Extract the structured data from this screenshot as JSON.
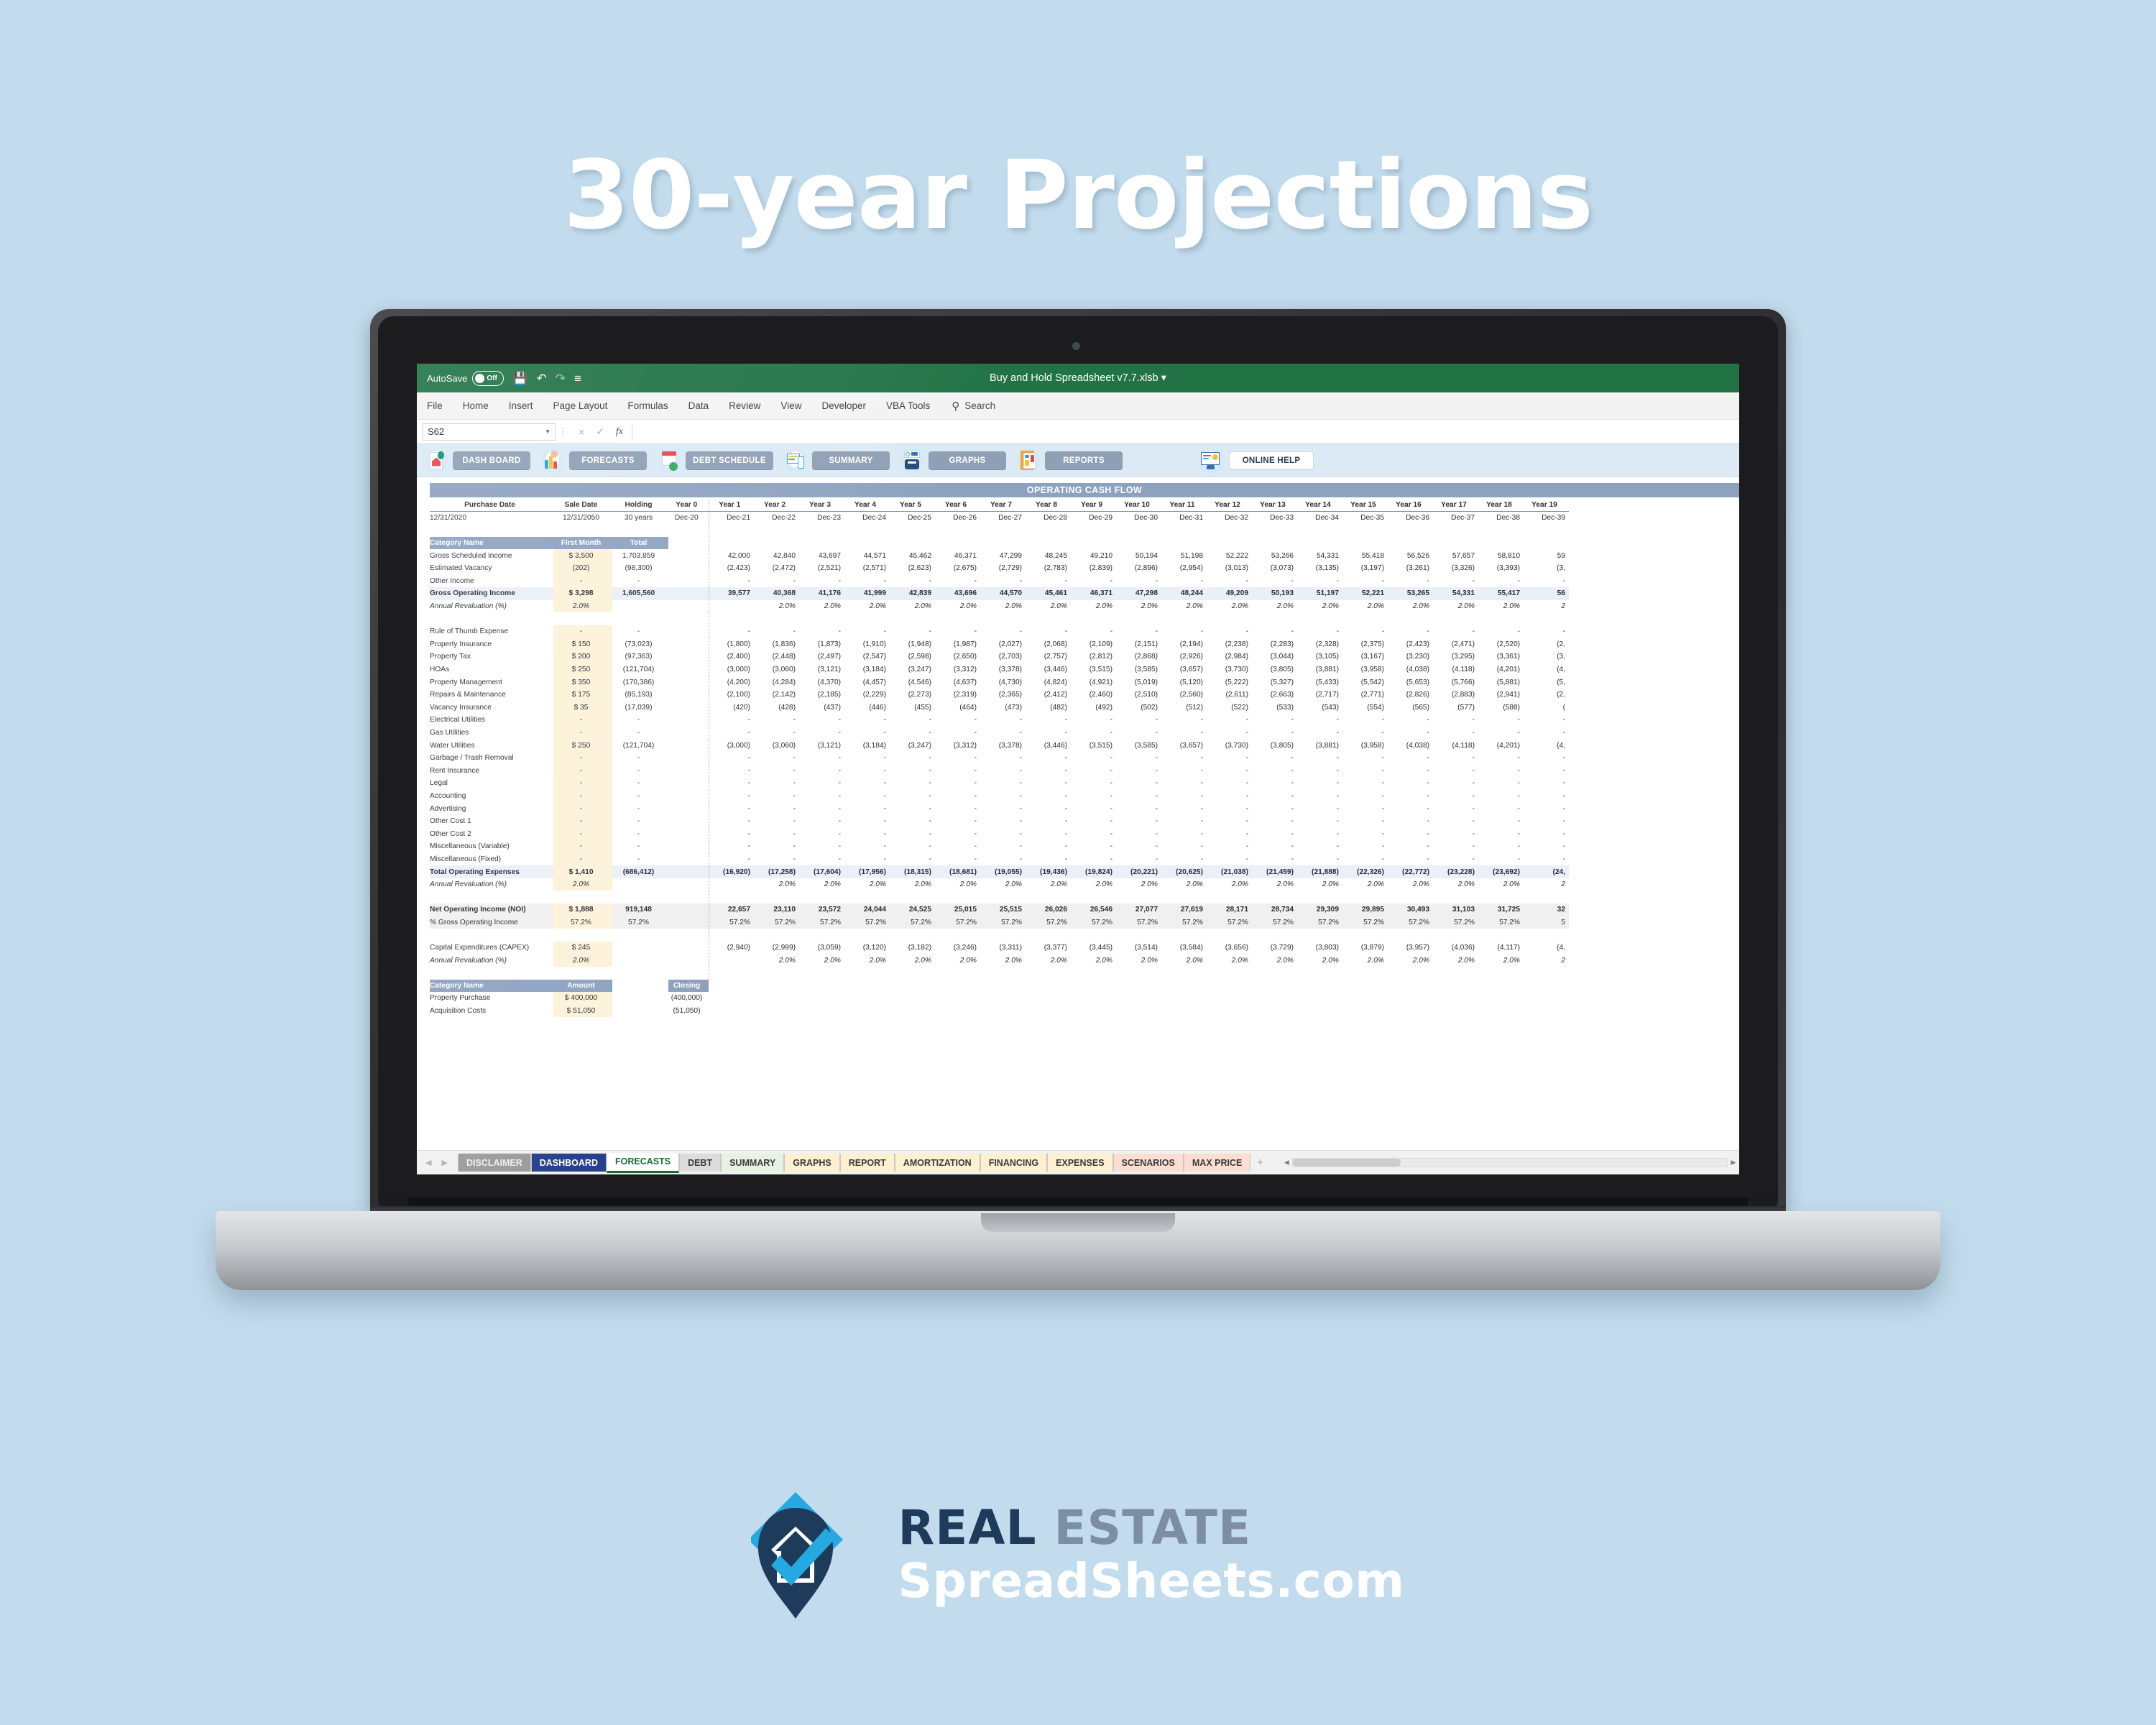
{
  "hero": {
    "title": "30-year Projections"
  },
  "excel": {
    "titlebar": {
      "autosave_label": "AutoSave",
      "autosave_state": "Off",
      "doc_title": "Buy and Hold Spreadsheet v7.7.xlsb",
      "qat_icons": [
        "save-icon",
        "undo-icon",
        "redo-icon",
        "customize-qat-icon"
      ]
    },
    "ribbon_tabs": [
      "File",
      "Home",
      "Insert",
      "Page Layout",
      "Formulas",
      "Data",
      "Review",
      "View",
      "Developer",
      "VBA Tools"
    ],
    "search_label": "Search",
    "formula_bar": {
      "name_box": "S62",
      "cancel": "×",
      "enter": "✓",
      "fx": "fx",
      "value": ""
    },
    "macro_buttons": [
      {
        "label": "DASH BOARD",
        "icon": "house-report-icon"
      },
      {
        "label": "FORECASTS",
        "icon": "chart-person-icon"
      },
      {
        "label": "DEBT SCHEDULE",
        "icon": "calendar-check-icon"
      },
      {
        "label": "SUMMARY",
        "icon": "monitor-mobile-icon"
      },
      {
        "label": "GRAPHS",
        "icon": "analytics-search-icon"
      },
      {
        "label": "REPORTS",
        "icon": "clipboard-report-icon"
      },
      {
        "label": "ONLINE HELP",
        "icon": "settings-monitor-icon"
      }
    ],
    "sheet_tabs": [
      {
        "label": "DISCLAIMER",
        "style": "t-disclaimer",
        "active": false
      },
      {
        "label": "DASHBOARD",
        "style": "t-dashboard",
        "active": false
      },
      {
        "label": "FORECASTS",
        "style": "t-active",
        "active": true
      },
      {
        "label": "DEBT",
        "style": "t-debt",
        "active": false
      },
      {
        "label": "SUMMARY",
        "style": "t-green",
        "active": false
      },
      {
        "label": "GRAPHS",
        "style": "t-yellow",
        "active": false
      },
      {
        "label": "REPORT",
        "style": "t-yellow",
        "active": false
      },
      {
        "label": "AMORTIZATION",
        "style": "t-yellow",
        "active": false
      },
      {
        "label": "FINANCING",
        "style": "t-yellow",
        "active": false
      },
      {
        "label": "EXPENSES",
        "style": "t-yellow",
        "active": false
      },
      {
        "label": "SCENARIOS",
        "style": "t-pink",
        "active": false
      },
      {
        "label": "MAX PRICE",
        "style": "t-pink",
        "active": false
      }
    ],
    "add_sheet_label": "+"
  },
  "chart_data": {
    "type": "table",
    "title": "OPERATING CASH FLOW",
    "meta_headers": [
      "Purchase Date",
      "Sale Date",
      "Holding",
      "Year 0"
    ],
    "meta_values": [
      "12/31/2020",
      "12/31/2050",
      "30 years",
      "Dec-20"
    ],
    "year_headers": [
      "Year 1",
      "Year 2",
      "Year 3",
      "Year 4",
      "Year 5",
      "Year 6",
      "Year 7",
      "Year 8",
      "Year 9",
      "Year 10",
      "Year 11",
      "Year 12",
      "Year 13",
      "Year 14",
      "Year 15",
      "Year 16",
      "Year 17",
      "Year 18",
      "Year 19"
    ],
    "year_dates": [
      "Dec-21",
      "Dec-22",
      "Dec-23",
      "Dec-24",
      "Dec-25",
      "Dec-26",
      "Dec-27",
      "Dec-28",
      "Dec-29",
      "Dec-30",
      "Dec-31",
      "Dec-32",
      "Dec-33",
      "Dec-34",
      "Dec-35",
      "Dec-36",
      "Dec-37",
      "Dec-38",
      "Dec-39"
    ],
    "section_headers": [
      "Category Name",
      "First Month",
      "Total"
    ],
    "rows": [
      {
        "label": "Gross Scheduled Income",
        "first_month": "$ 3,500",
        "total": "1,703,859",
        "values": [
          "42,000",
          "42,840",
          "43,697",
          "44,571",
          "45,462",
          "46,371",
          "47,299",
          "48,245",
          "49,210",
          "50,194",
          "51,198",
          "52,222",
          "53,266",
          "54,331",
          "55,418",
          "56,526",
          "57,657",
          "58,810",
          "59"
        ]
      },
      {
        "label": "Estimated Vacancy",
        "first_month": "(202)",
        "total": "(98,300)",
        "values": [
          "(2,423)",
          "(2,472)",
          "(2,521)",
          "(2,571)",
          "(2,623)",
          "(2,675)",
          "(2,729)",
          "(2,783)",
          "(2,839)",
          "(2,896)",
          "(2,954)",
          "(3,013)",
          "(3,073)",
          "(3,135)",
          "(3,197)",
          "(3,261)",
          "(3,326)",
          "(3,393)",
          "(3,"
        ]
      },
      {
        "label": "Other Income",
        "first_month": "-",
        "total": "-",
        "values": [
          "-",
          "-",
          "-",
          "-",
          "-",
          "-",
          "-",
          "-",
          "-",
          "-",
          "-",
          "-",
          "-",
          "-",
          "-",
          "-",
          "-",
          "-",
          "-"
        ]
      },
      {
        "label": "Gross Operating Income",
        "first_month": "$ 3,298",
        "total": "1,605,560",
        "style": "total-blue",
        "values": [
          "39,577",
          "40,368",
          "41,176",
          "41,999",
          "42,839",
          "43,696",
          "44,570",
          "45,461",
          "46,371",
          "47,298",
          "48,244",
          "49,209",
          "50,193",
          "51,197",
          "52,221",
          "53,265",
          "54,331",
          "55,417",
          "56"
        ]
      },
      {
        "label": "Annual Revaluation (%)",
        "first_month": "2.0%",
        "total": "",
        "style": "italic-cream",
        "values": [
          "",
          "2.0%",
          "2.0%",
          "2.0%",
          "2.0%",
          "2.0%",
          "2.0%",
          "2.0%",
          "2.0%",
          "2.0%",
          "2.0%",
          "2.0%",
          "2.0%",
          "2.0%",
          "2.0%",
          "2.0%",
          "2.0%",
          "2.0%",
          "2"
        ]
      },
      {
        "label": "",
        "first_month": "",
        "total": "",
        "style": "gap",
        "values": []
      },
      {
        "label": "Rule of Thumb Expense",
        "first_month": "-",
        "total": "-",
        "values": [
          "-",
          "-",
          "-",
          "-",
          "-",
          "-",
          "-",
          "-",
          "-",
          "-",
          "-",
          "-",
          "-",
          "-",
          "-",
          "-",
          "-",
          "-",
          "-"
        ]
      },
      {
        "label": "Property Insurance",
        "first_month": "$ 150",
        "total": "(73,023)",
        "values": [
          "(1,800)",
          "(1,836)",
          "(1,873)",
          "(1,910)",
          "(1,948)",
          "(1,987)",
          "(2,027)",
          "(2,068)",
          "(2,109)",
          "(2,151)",
          "(2,194)",
          "(2,238)",
          "(2,283)",
          "(2,328)",
          "(2,375)",
          "(2,423)",
          "(2,471)",
          "(2,520)",
          "(2,"
        ]
      },
      {
        "label": "Property Tax",
        "first_month": "$ 200",
        "total": "(97,363)",
        "values": [
          "(2,400)",
          "(2,448)",
          "(2,497)",
          "(2,547)",
          "(2,598)",
          "(2,650)",
          "(2,703)",
          "(2,757)",
          "(2,812)",
          "(2,868)",
          "(2,926)",
          "(2,984)",
          "(3,044)",
          "(3,105)",
          "(3,167)",
          "(3,230)",
          "(3,295)",
          "(3,361)",
          "(3,"
        ]
      },
      {
        "label": "HOAs",
        "first_month": "$ 250",
        "total": "(121,704)",
        "values": [
          "(3,000)",
          "(3,060)",
          "(3,121)",
          "(3,184)",
          "(3,247)",
          "(3,312)",
          "(3,378)",
          "(3,446)",
          "(3,515)",
          "(3,585)",
          "(3,657)",
          "(3,730)",
          "(3,805)",
          "(3,881)",
          "(3,958)",
          "(4,038)",
          "(4,118)",
          "(4,201)",
          "(4,"
        ]
      },
      {
        "label": "Property Management",
        "first_month": "$ 350",
        "total": "(170,386)",
        "values": [
          "(4,200)",
          "(4,284)",
          "(4,370)",
          "(4,457)",
          "(4,546)",
          "(4,637)",
          "(4,730)",
          "(4,824)",
          "(4,921)",
          "(5,019)",
          "(5,120)",
          "(5,222)",
          "(5,327)",
          "(5,433)",
          "(5,542)",
          "(5,653)",
          "(5,766)",
          "(5,881)",
          "(5,"
        ]
      },
      {
        "label": "Repairs & Maintenance",
        "first_month": "$ 175",
        "total": "(85,193)",
        "values": [
          "(2,100)",
          "(2,142)",
          "(2,185)",
          "(2,229)",
          "(2,273)",
          "(2,319)",
          "(2,365)",
          "(2,412)",
          "(2,460)",
          "(2,510)",
          "(2,560)",
          "(2,611)",
          "(2,663)",
          "(2,717)",
          "(2,771)",
          "(2,826)",
          "(2,883)",
          "(2,941)",
          "(2,"
        ]
      },
      {
        "label": "Vacancy Insurance",
        "first_month": "$ 35",
        "total": "(17,039)",
        "values": [
          "(420)",
          "(428)",
          "(437)",
          "(446)",
          "(455)",
          "(464)",
          "(473)",
          "(482)",
          "(492)",
          "(502)",
          "(512)",
          "(522)",
          "(533)",
          "(543)",
          "(554)",
          "(565)",
          "(577)",
          "(588)",
          "("
        ]
      },
      {
        "label": "Electrical Utilities",
        "first_month": "-",
        "total": "-",
        "values": [
          "-",
          "-",
          "-",
          "-",
          "-",
          "-",
          "-",
          "-",
          "-",
          "-",
          "-",
          "-",
          "-",
          "-",
          "-",
          "-",
          "-",
          "-",
          "-"
        ]
      },
      {
        "label": "Gas Utilities",
        "first_month": "-",
        "total": "-",
        "values": [
          "-",
          "-",
          "-",
          "-",
          "-",
          "-",
          "-",
          "-",
          "-",
          "-",
          "-",
          "-",
          "-",
          "-",
          "-",
          "-",
          "-",
          "-",
          "-"
        ]
      },
      {
        "label": "Water Utilities",
        "first_month": "$ 250",
        "total": "(121,704)",
        "values": [
          "(3,000)",
          "(3,060)",
          "(3,121)",
          "(3,184)",
          "(3,247)",
          "(3,312)",
          "(3,378)",
          "(3,446)",
          "(3,515)",
          "(3,585)",
          "(3,657)",
          "(3,730)",
          "(3,805)",
          "(3,881)",
          "(3,958)",
          "(4,038)",
          "(4,118)",
          "(4,201)",
          "(4,"
        ]
      },
      {
        "label": "Garbage / Trash Removal",
        "first_month": "-",
        "total": "-",
        "values": [
          "-",
          "-",
          "-",
          "-",
          "-",
          "-",
          "-",
          "-",
          "-",
          "-",
          "-",
          "-",
          "-",
          "-",
          "-",
          "-",
          "-",
          "-",
          "-"
        ]
      },
      {
        "label": "Rent Insurance",
        "first_month": "-",
        "total": "-",
        "values": [
          "-",
          "-",
          "-",
          "-",
          "-",
          "-",
          "-",
          "-",
          "-",
          "-",
          "-",
          "-",
          "-",
          "-",
          "-",
          "-",
          "-",
          "-",
          "-"
        ]
      },
      {
        "label": "Legal",
        "first_month": "-",
        "total": "-",
        "values": [
          "-",
          "-",
          "-",
          "-",
          "-",
          "-",
          "-",
          "-",
          "-",
          "-",
          "-",
          "-",
          "-",
          "-",
          "-",
          "-",
          "-",
          "-",
          "-"
        ]
      },
      {
        "label": "Accounting",
        "first_month": "-",
        "total": "-",
        "values": [
          "-",
          "-",
          "-",
          "-",
          "-",
          "-",
          "-",
          "-",
          "-",
          "-",
          "-",
          "-",
          "-",
          "-",
          "-",
          "-",
          "-",
          "-",
          "-"
        ]
      },
      {
        "label": "Advertising",
        "first_month": "-",
        "total": "-",
        "values": [
          "-",
          "-",
          "-",
          "-",
          "-",
          "-",
          "-",
          "-",
          "-",
          "-",
          "-",
          "-",
          "-",
          "-",
          "-",
          "-",
          "-",
          "-",
          "-"
        ]
      },
      {
        "label": "Other Cost 1",
        "first_month": "-",
        "total": "-",
        "values": [
          "-",
          "-",
          "-",
          "-",
          "-",
          "-",
          "-",
          "-",
          "-",
          "-",
          "-",
          "-",
          "-",
          "-",
          "-",
          "-",
          "-",
          "-",
          "-"
        ]
      },
      {
        "label": "Other Cost 2",
        "first_month": "-",
        "total": "-",
        "values": [
          "-",
          "-",
          "-",
          "-",
          "-",
          "-",
          "-",
          "-",
          "-",
          "-",
          "-",
          "-",
          "-",
          "-",
          "-",
          "-",
          "-",
          "-",
          "-"
        ]
      },
      {
        "label": "Miscellaneous (Variable)",
        "first_month": "-",
        "total": "-",
        "values": [
          "-",
          "-",
          "-",
          "-",
          "-",
          "-",
          "-",
          "-",
          "-",
          "-",
          "-",
          "-",
          "-",
          "-",
          "-",
          "-",
          "-",
          "-",
          "-"
        ]
      },
      {
        "label": "Miscellaneous (Fixed)",
        "first_month": "-",
        "total": "-",
        "values": [
          "-",
          "-",
          "-",
          "-",
          "-",
          "-",
          "-",
          "-",
          "-",
          "-",
          "-",
          "-",
          "-",
          "-",
          "-",
          "-",
          "-",
          "-",
          "-"
        ]
      },
      {
        "label": "Total Operating Expenses",
        "first_month": "$ 1,410",
        "total": "(686,412)",
        "style": "total-blue",
        "values": [
          "(16,920)",
          "(17,258)",
          "(17,604)",
          "(17,956)",
          "(18,315)",
          "(18,681)",
          "(19,055)",
          "(19,436)",
          "(19,824)",
          "(20,221)",
          "(20,625)",
          "(21,038)",
          "(21,459)",
          "(21,888)",
          "(22,326)",
          "(22,772)",
          "(23,228)",
          "(23,692)",
          "(24,"
        ]
      },
      {
        "label": "Annual Revaluation (%)",
        "first_month": "2.0%",
        "total": "",
        "style": "italic-cream",
        "values": [
          "",
          "2.0%",
          "2.0%",
          "2.0%",
          "2.0%",
          "2.0%",
          "2.0%",
          "2.0%",
          "2.0%",
          "2.0%",
          "2.0%",
          "2.0%",
          "2.0%",
          "2.0%",
          "2.0%",
          "2.0%",
          "2.0%",
          "2.0%",
          "2"
        ]
      },
      {
        "label": "",
        "first_month": "",
        "total": "",
        "style": "gap",
        "values": []
      },
      {
        "label": "Net Operating Income (NOI)",
        "first_month": "$ 1,888",
        "total": "919,148",
        "style": "total-gray",
        "values": [
          "22,657",
          "23,110",
          "23,572",
          "24,044",
          "24,525",
          "25,015",
          "25,515",
          "26,026",
          "26,546",
          "27,077",
          "27,619",
          "28,171",
          "28,734",
          "29,309",
          "29,895",
          "30,493",
          "31,103",
          "31,725",
          "32"
        ]
      },
      {
        "label": "% Gross Operating Income",
        "first_month": "57.2%",
        "total": "57.2%",
        "style": "pct-gray",
        "values": [
          "57.2%",
          "57.2%",
          "57.2%",
          "57.2%",
          "57.2%",
          "57.2%",
          "57.2%",
          "57.2%",
          "57.2%",
          "57.2%",
          "57.2%",
          "57.2%",
          "57.2%",
          "57.2%",
          "57.2%",
          "57.2%",
          "57.2%",
          "57.2%",
          "5"
        ]
      },
      {
        "label": "",
        "first_month": "",
        "total": "",
        "style": "gap",
        "values": []
      },
      {
        "label": "Capital Expenditures (CAPEX)",
        "first_month": "$ 245",
        "total": "",
        "values": [
          "(2,940)",
          "(2,999)",
          "(3,059)",
          "(3,120)",
          "(3,182)",
          "(3,246)",
          "(3,311)",
          "(3,377)",
          "(3,445)",
          "(3,514)",
          "(3,584)",
          "(3,656)",
          "(3,729)",
          "(3,803)",
          "(3,879)",
          "(3,957)",
          "(4,036)",
          "(4,117)",
          "(4,"
        ]
      },
      {
        "label": "Annual Revaluation (%)",
        "first_month": "2.0%",
        "total": "",
        "style": "italic-cream",
        "values": [
          "",
          "2.0%",
          "2.0%",
          "2.0%",
          "2.0%",
          "2.0%",
          "2.0%",
          "2.0%",
          "2.0%",
          "2.0%",
          "2.0%",
          "2.0%",
          "2.0%",
          "2.0%",
          "2.0%",
          "2.0%",
          "2.0%",
          "2.0%",
          "2"
        ]
      },
      {
        "label": "",
        "first_month": "",
        "total": "",
        "style": "gap",
        "values": []
      }
    ],
    "bottom_section": {
      "headers": [
        "Category Name",
        "Amount",
        "Closing"
      ],
      "rows": [
        {
          "label": "Property Purchase",
          "amount": "$ 400,000",
          "closing": "(400,000)"
        },
        {
          "label": "Acquisition Costs",
          "amount": "$ 51,050",
          "closing": "(51,050)"
        }
      ]
    }
  },
  "logo": {
    "line1_dark": "REAL",
    "line1_gray": "ESTATE",
    "line2": "SpreadSheets.com",
    "mark": "house-pin-check-icon",
    "colors": {
      "dark": "#1f3b5c",
      "gray": "#7d8da3",
      "cyan": "#26a9e0"
    }
  }
}
